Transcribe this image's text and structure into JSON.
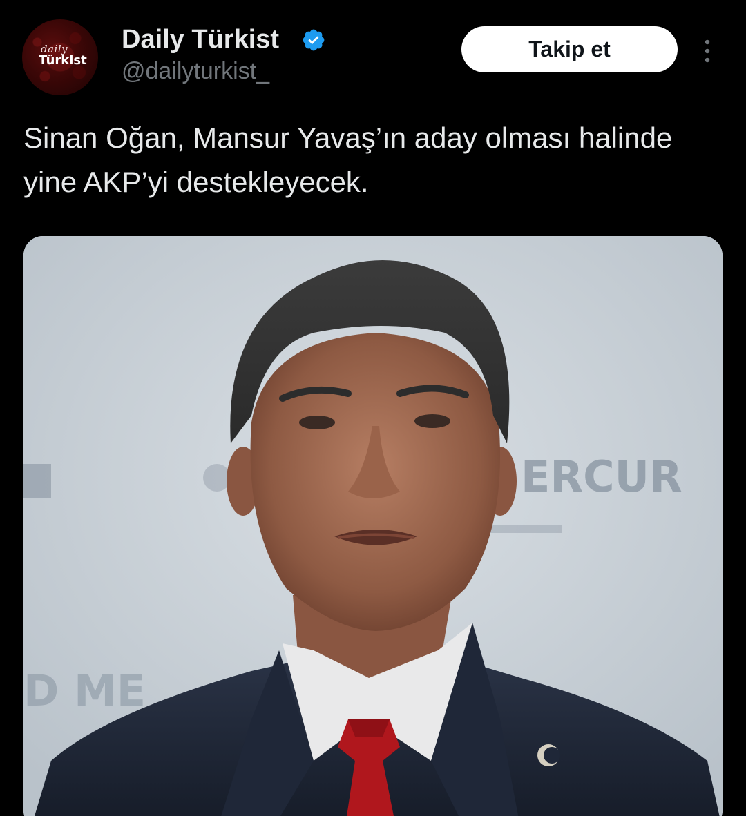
{
  "account": {
    "display_name": "Daily Türkist",
    "handle": "@dailyturkist_",
    "avatar_text_small": "daily",
    "avatar_text_big": "Türkist",
    "verified": true
  },
  "actions": {
    "follow_label": "Takip et",
    "more_icon": "vertical-ellipsis-icon"
  },
  "tweet": {
    "text": "Sinan Oğan, Mansur Yavaş’ın aday olması halinde yine AKP’yi destekleyecek."
  },
  "media": {
    "backdrop_letters_top": "ERCUR",
    "backdrop_letters_bottom": "D ME"
  },
  "colors": {
    "background": "#000000",
    "text_primary": "#e7e9ea",
    "text_secondary": "#71767b",
    "verified_badge": "#1d9bf0",
    "follow_button_bg": "#ffffff",
    "follow_button_text": "#0f1419"
  }
}
